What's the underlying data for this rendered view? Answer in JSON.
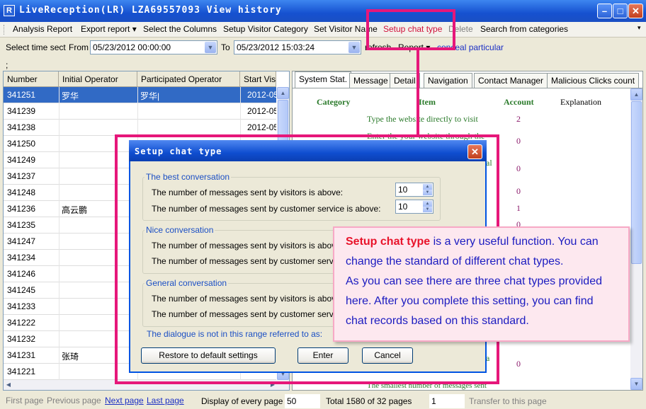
{
  "window": {
    "app_icon": "R",
    "title": "LiveReception(LR) LZA69557093  View history"
  },
  "toolbar": {
    "items": [
      "Analysis Report",
      "Export report ▾",
      "Select the Columns",
      "Setup Visitor Category",
      "Set Visitor Name",
      "Setup chat type",
      "Delete",
      "Search from categories"
    ],
    "overflow_icon": "chevron-down-icon"
  },
  "filter": {
    "label": "Select time sect",
    "from_label": "From",
    "from_value": "05/23/2012 00:00:00",
    "to_label": "To",
    "to_value": "05/23/2012 15:03:24",
    "refresh": "refresh",
    "report": "Report ▾",
    "conceal": "conceal particular",
    "semicolon": ";"
  },
  "table": {
    "headers": [
      "Number",
      "Initial Operator",
      "Participated Operator",
      "Start Visit"
    ],
    "rows": [
      {
        "number": "341251",
        "initial": "罗华",
        "participated": "罗华|",
        "start": "2012-05"
      },
      {
        "number": "341239",
        "initial": "",
        "participated": "",
        "start": "2012-05"
      },
      {
        "number": "341238",
        "initial": "",
        "participated": "",
        "start": "2012-05"
      },
      {
        "number": "341250",
        "initial": "",
        "participated": "",
        "start": ""
      },
      {
        "number": "341249",
        "initial": "",
        "participated": "",
        "start": ""
      },
      {
        "number": "341237",
        "initial": "",
        "participated": "",
        "start": ""
      },
      {
        "number": "341248",
        "initial": "",
        "participated": "",
        "start": ""
      },
      {
        "number": "341236",
        "initial": "高云鹏",
        "participated": "",
        "start": ""
      },
      {
        "number": "341235",
        "initial": "",
        "participated": "",
        "start": ""
      },
      {
        "number": "341247",
        "initial": "",
        "participated": "",
        "start": ""
      },
      {
        "number": "341234",
        "initial": "",
        "participated": "",
        "start": ""
      },
      {
        "number": "341246",
        "initial": "",
        "participated": "",
        "start": ""
      },
      {
        "number": "341245",
        "initial": "",
        "participated": "",
        "start": ""
      },
      {
        "number": "341233",
        "initial": "",
        "participated": "",
        "start": ""
      },
      {
        "number": "341222",
        "initial": "",
        "participated": "",
        "start": ""
      },
      {
        "number": "341232",
        "initial": "",
        "participated": "",
        "start": ""
      },
      {
        "number": "341231",
        "initial": "张琦",
        "participated": "",
        "start": ""
      },
      {
        "number": "341221",
        "initial": "",
        "participated": "",
        "start": ""
      }
    ]
  },
  "tabs": [
    "System Stat.",
    "Message",
    "Detail",
    "Navigation",
    "Contact Manager",
    "Malicious Clicks count"
  ],
  "stats": {
    "headers": {
      "category": "Category",
      "item": "Item",
      "account": "Account",
      "explanation": "Explanation"
    },
    "rows": [
      {
        "item": "Type the website directly to visit",
        "account": "2"
      },
      {
        "item": "Enter the your website through the",
        "account": "0"
      },
      {
        "item": "al",
        "account": "0"
      },
      {
        "item": "",
        "account": "0"
      },
      {
        "item": "",
        "account": "1"
      },
      {
        "item": "",
        "account": "0"
      }
    ],
    "bottom_item": "a",
    "bottom_account": "0",
    "last_item": "The smallest number of messages sent"
  },
  "dialog": {
    "title": "Setup chat type",
    "groups": [
      {
        "legend": "The best conversation",
        "visitor_label": "The number of messages sent by visitors is above:",
        "visitor_value": "10",
        "service_label": "The number of messages sent by customer service is above:",
        "service_value": "10"
      },
      {
        "legend": "Nice conversation",
        "visitor_label": "The number of messages sent by visitors is above:",
        "service_label": "The number of messages sent by customer service is above:"
      },
      {
        "legend": "General conversation",
        "visitor_label": "The number of messages sent by visitors is above:",
        "service_label": "The number of messages sent by customer service is above:"
      }
    ],
    "note": "The dialogue is not in this range referred to as:",
    "restore": "Restore to default settings",
    "enter": "Enter",
    "cancel": "Cancel"
  },
  "callout": {
    "highlight": "Setup chat type",
    "line1_rest": " is a very useful function. You can",
    "line2": "change the standard of different chat types.",
    "line3": "As you can see there are three chat types provided",
    "line4": "here. After you complete this setting, you can find",
    "line5": "chat records based on this standard."
  },
  "status": {
    "first": "First page",
    "previous": "Previous page",
    "next": "Next page",
    "last": "Last page",
    "display_label": "Display of every page",
    "display_value": "50",
    "total": "Total 1580 of 32 pages",
    "page_value": "1",
    "transfer": "Transfer to this page"
  },
  "colors": {
    "highlight_frame": "#e6177a",
    "callout_highlight": "#e8132a",
    "callout_text": "#1b1bc0",
    "selected_row": "#316ac5"
  }
}
